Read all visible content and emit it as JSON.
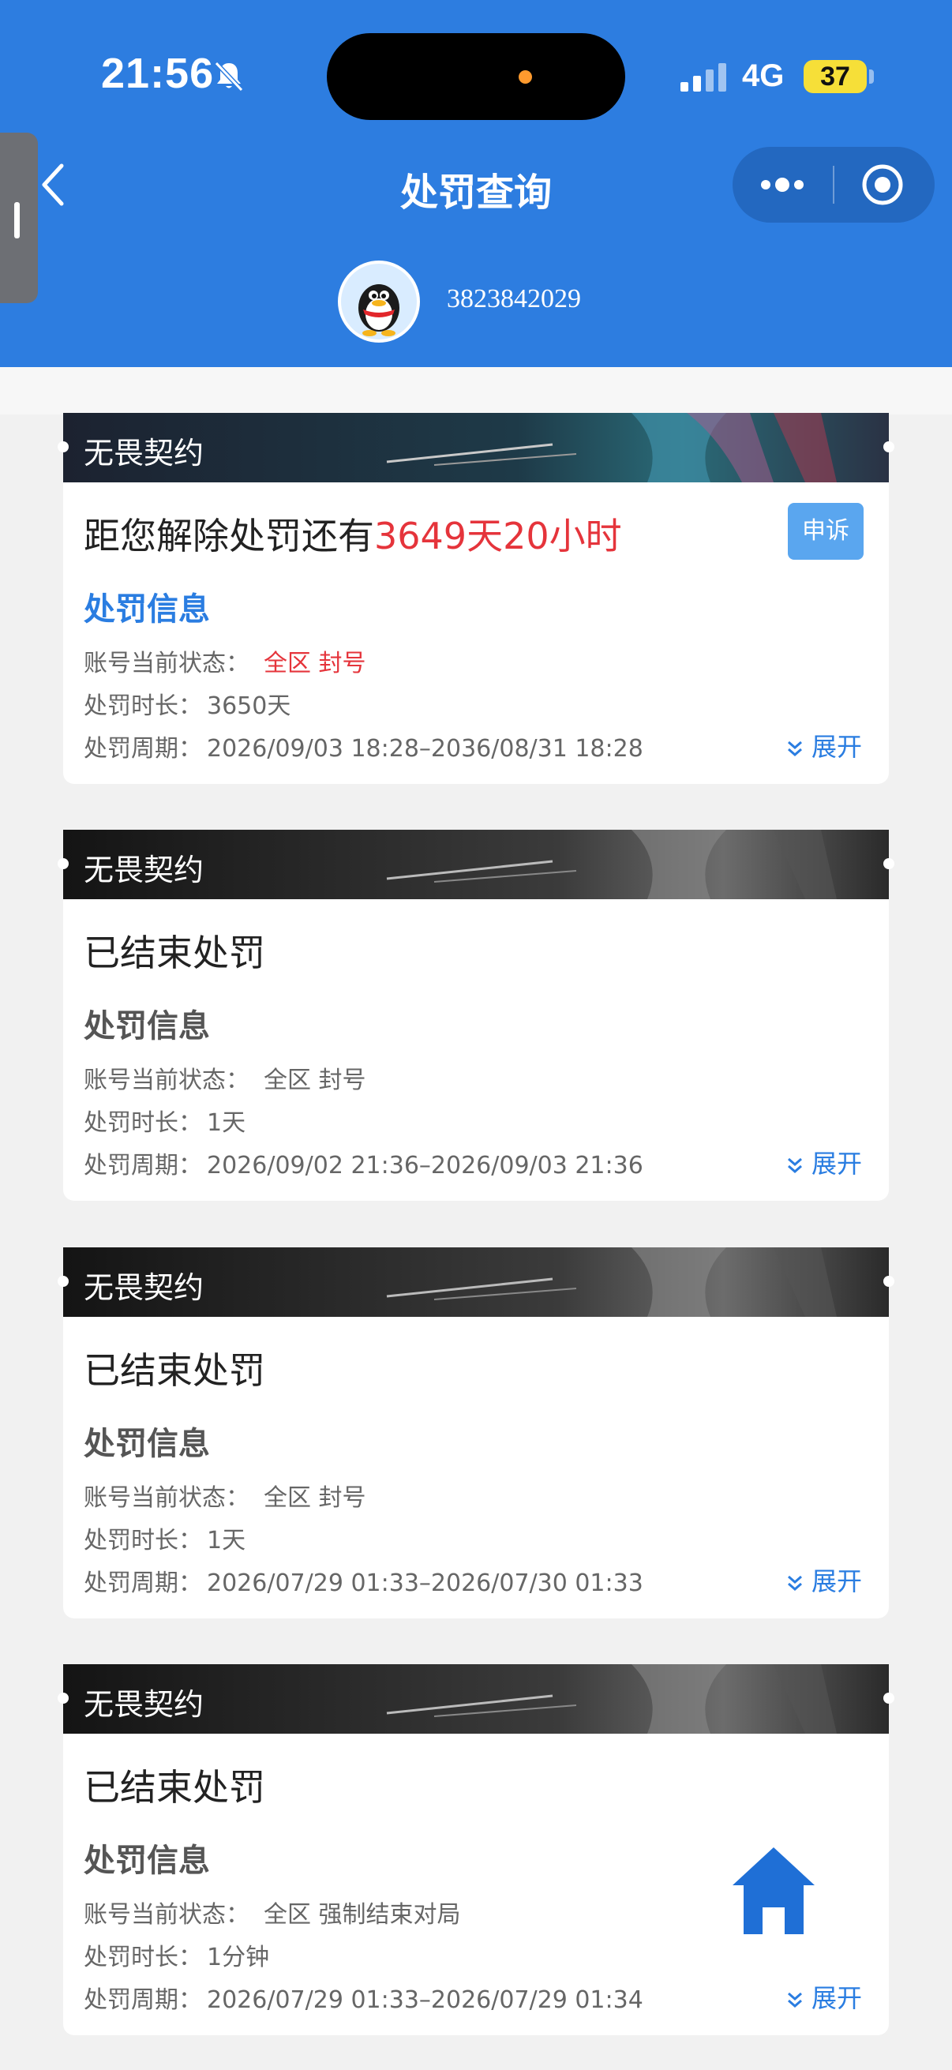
{
  "status_bar": {
    "time": "21:56",
    "network": "4G",
    "battery": "37"
  },
  "header": {
    "title": "处罚查询",
    "account_id": "3823842029"
  },
  "cards": [
    {
      "game": "无畏契约",
      "headline_prefix": "距您解除处罚还有",
      "headline_highlight": "3649天20小时",
      "appeal_label": "申诉",
      "info_title": "处罚信息",
      "status_label": "账号当前状态：",
      "status_value": "全区 封号",
      "duration_label": "处罚时长：",
      "duration_value": "3650天",
      "period_label": "处罚周期：",
      "period_value": "2026/09/03 18:28–2036/08/31 18:28",
      "expand_label": "展开"
    },
    {
      "game": "无畏契约",
      "headline": "已结束处罚",
      "info_title": "处罚信息",
      "status_label": "账号当前状态：",
      "status_value": "全区 封号",
      "duration_label": "处罚时长：",
      "duration_value": "1天",
      "period_label": "处罚周期：",
      "period_value": "2026/09/02 21:36–2026/09/03 21:36",
      "expand_label": "展开"
    },
    {
      "game": "无畏契约",
      "headline": "已结束处罚",
      "info_title": "处罚信息",
      "status_label": "账号当前状态：",
      "status_value": "全区 封号",
      "duration_label": "处罚时长：",
      "duration_value": "1天",
      "period_label": "处罚周期：",
      "period_value": "2026/07/29 01:33–2026/07/30 01:33",
      "expand_label": "展开"
    },
    {
      "game": "无畏契约",
      "headline": "已结束处罚",
      "info_title": "处罚信息",
      "status_label": "账号当前状态：",
      "status_value": "全区 强制结束对局",
      "duration_label": "处罚时长：",
      "duration_value": "1分钟",
      "period_label": "处罚周期：",
      "period_value": "2026/07/29 01:33–2026/07/29 01:34",
      "expand_label": "展开"
    }
  ],
  "colors": {
    "header_blue": "#2d7de0",
    "accent_blue": "#2a7de1",
    "alert_red": "#e5343b",
    "appeal_blue": "#5aa6ef"
  },
  "icons": [
    "bell-muted-icon",
    "signal-icon",
    "back-icon",
    "more-icon",
    "target-icon",
    "qq-penguin-avatar",
    "chevron-double-down-icon",
    "home-icon"
  ]
}
